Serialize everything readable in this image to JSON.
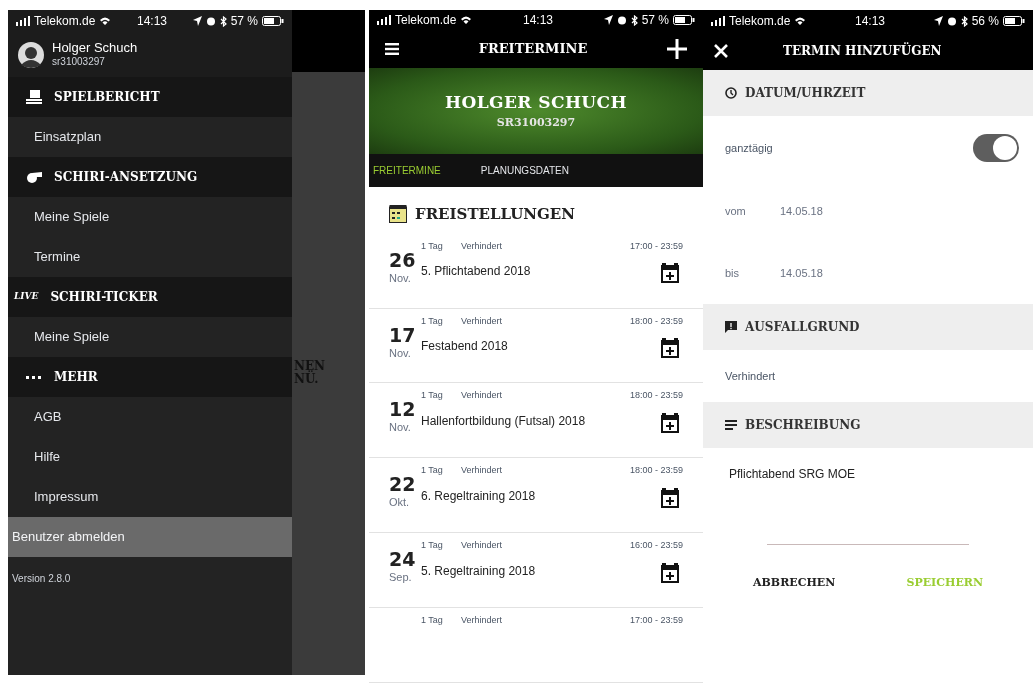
{
  "drawer_screen": {
    "status_bar": {
      "carrier": "Telekom.de",
      "time": "14:13",
      "battery": "57 %"
    },
    "profile": {
      "name": "Holger Schuch",
      "id": "sr31003297"
    },
    "menu": [
      {
        "kind": "section",
        "label": "SPIELBERICHT",
        "selected": false
      },
      {
        "kind": "item",
        "label": "Einsatzplan",
        "selected": false
      },
      {
        "kind": "section",
        "label": "SCHIRI-ANSETZUNG",
        "selected": false
      },
      {
        "kind": "item",
        "label": "Meine Spiele",
        "selected": false
      },
      {
        "kind": "item",
        "label": "Termine",
        "selected": false
      },
      {
        "kind": "section",
        "badge": "LIVE",
        "label": "SCHIRI-TICKER",
        "selected": false
      },
      {
        "kind": "item",
        "label": "Meine Spiele",
        "selected": false
      },
      {
        "kind": "section",
        "label": "MEHR",
        "selected": false
      },
      {
        "kind": "item",
        "label": "AGB",
        "selected": false
      },
      {
        "kind": "item",
        "label": "Hilfe",
        "selected": false
      },
      {
        "kind": "item",
        "label": "Impressum",
        "selected": false
      },
      {
        "kind": "item",
        "label": "Benutzer abmelden",
        "selected": true
      }
    ],
    "version": "Version 2.8.0",
    "background_text": [
      "NEN",
      "NÜ."
    ]
  },
  "list_screen": {
    "status_bar": {
      "carrier": "Telekom.de",
      "time": "14:13",
      "battery": "57 %"
    },
    "title": "FREITERMINE",
    "banner": {
      "name": "HOLGER SCHUCH",
      "id": "SR31003297"
    },
    "tabs": [
      {
        "label": "FREITERMINE",
        "selected": true
      },
      {
        "label": "PLANUNGSDATEN",
        "selected": false
      }
    ],
    "section_title": "FREISTELLUNGEN",
    "entries": [
      {
        "day": "26",
        "month": "Nov.",
        "duration": "1 Tag",
        "reason": "Verhindert",
        "time": "17:00 - 23:59",
        "title": "5. Pflichtabend 2018"
      },
      {
        "day": "17",
        "month": "Nov.",
        "duration": "1 Tag",
        "reason": "Verhindert",
        "time": "18:00 - 23:59",
        "title": "Festabend 2018"
      },
      {
        "day": "12",
        "month": "Nov.",
        "duration": "1 Tag",
        "reason": "Verhindert",
        "time": "18:00 - 23:59",
        "title": "Hallenfortbildung (Futsal) 2018"
      },
      {
        "day": "22",
        "month": "Okt.",
        "duration": "1 Tag",
        "reason": "Verhindert",
        "time": "18:00 - 23:59",
        "title": "6. Regeltraining 2018"
      },
      {
        "day": "24",
        "month": "Sep.",
        "duration": "1 Tag",
        "reason": "Verhindert",
        "time": "16:00 - 23:59",
        "title": "5. Regeltraining 2018"
      },
      {
        "duration": "1 Tag",
        "reason": "Verhindert",
        "time": "17:00 - 23:59"
      }
    ]
  },
  "form_screen": {
    "status_bar": {
      "carrier": "Telekom.de",
      "time": "14:13",
      "battery": "56 %"
    },
    "title": "TERMIN HINZUFÜGEN",
    "sections": [
      {
        "kind": "datetime",
        "title": "DATUM/UHRZEIT",
        "all_day": {
          "label": "ganztägig",
          "on": true
        },
        "fields": [
          {
            "label": "vom",
            "value": "14.05.18"
          },
          {
            "label": "bis",
            "value": "14.05.18"
          }
        ]
      },
      {
        "kind": "text",
        "title": "AUSFALLGRUND",
        "value": "Verhindert"
      },
      {
        "kind": "text",
        "title": "BESCHREIBUNG",
        "value": "Pflichtabend SRG MOE"
      }
    ],
    "buttons": [
      {
        "label": "ABBRECHEN",
        "kind": "cancel"
      },
      {
        "label": "SPEICHERN",
        "kind": "save"
      }
    ]
  }
}
